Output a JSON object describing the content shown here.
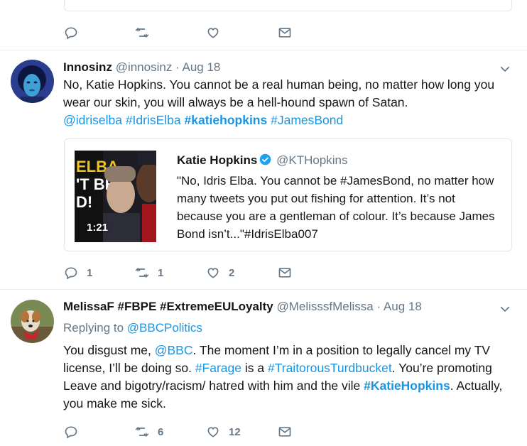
{
  "top_actions": {
    "reply_count": "",
    "retweet_count": "",
    "like_count": ""
  },
  "tweet1": {
    "name": "Innosinz",
    "handle": "@innosinz",
    "separator": " · ",
    "date": "Aug 18",
    "text_line1": "No, Katie Hopkins. You cannot be a real human being, no matter how long you",
    "text_line2": "wear our skin, you will always be a hell-hound spawn of Satan.",
    "tags": [
      "@idriselba",
      "#IdrisElba",
      "#katiehopkins",
      "#JamesBond"
    ],
    "quote": {
      "name": "Katie Hopkins",
      "handle": "@KTHopkins",
      "thumb_title_lines": [
        "ELBA",
        "'T BE",
        "D!"
      ],
      "video_duration": "1:21",
      "text_lines": [
        "\"No, Idris Elba. You cannot be #JamesBond, no matter how",
        "many tweets you put out fishing for attention. It’s not",
        "because you are a gentleman of colour. It’s because James",
        "Bond isn’t...\"#IdrisElba007"
      ]
    },
    "reply_count": "1",
    "retweet_count": "1",
    "like_count": "2"
  },
  "tweet2": {
    "name": "MelissaF #FBPE #ExtremeEULoyalty",
    "handle": "@MelisssfMelissa",
    "separator": " · ",
    "date": "Aug 18",
    "replying_prefix": "Replying to ",
    "replying_to": "@BBCPolitics",
    "line1_a": "You disgust me, ",
    "line1_link": "@BBC",
    "line1_b": ". The moment I’m in a position to legally cancel my TV",
    "line2_a": "license, I’ll be doing so. ",
    "line2_link1": "#Farage",
    "line2_b": " is a ",
    "line2_link2": "#TraitorousTurdbucket",
    "line2_c": ". You’re promoting",
    "line3_a": "Leave and bigotry/racism/ hatred with him and the vile ",
    "line3_link": "#KatieHopkins",
    "line3_b": ". Actually,",
    "line4": "you make me sick.",
    "reply_count": "",
    "retweet_count": "6",
    "like_count": "12"
  },
  "colors": {
    "link": "#1b95e0",
    "meta": "#657786",
    "text": "#14171a",
    "border": "#e1e8ed",
    "verified": "#1da1f2"
  },
  "icons": [
    "reply-icon",
    "retweet-icon",
    "like-icon",
    "dm-icon",
    "chevron-down-icon",
    "verified-icon"
  ]
}
